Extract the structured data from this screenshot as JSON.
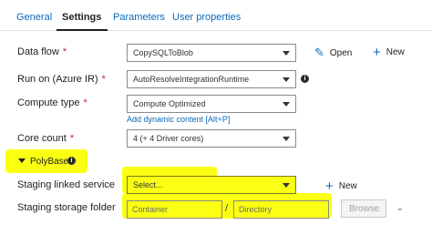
{
  "tabs": [
    {
      "label": "General"
    },
    {
      "label": "Settings",
      "active": true
    },
    {
      "label": "Parameters"
    },
    {
      "label": "User properties"
    }
  ],
  "form": {
    "data_flow": {
      "label": "Data flow",
      "required": "*",
      "value": "CopySQLToBlob",
      "open_label": "Open",
      "new_label": "New"
    },
    "run_on": {
      "label": "Run on (Azure IR)",
      "required": "*",
      "value": "AutoResolveIntegrationRuntime"
    },
    "compute_type": {
      "label": "Compute type",
      "required": "*",
      "value": "Compute Optimized",
      "link": "Add dynamic content [Alt+P]"
    },
    "core_count": {
      "label": "Core count",
      "required": "*",
      "value": "4 (+ 4 Driver cores)"
    },
    "polybase": {
      "label": "PolyBase"
    },
    "staging_linked_service": {
      "label": "Staging linked service",
      "value": "Select...",
      "new_label": "New"
    },
    "staging_storage_folder": {
      "label": "Staging storage folder",
      "container_placeholder": "Container",
      "separator": "/",
      "directory_placeholder": "Directory",
      "browse_label": "Browse"
    }
  },
  "colors": {
    "accent": "#0b6abf",
    "highlight": "#fbff14",
    "required": "#c4262e"
  }
}
